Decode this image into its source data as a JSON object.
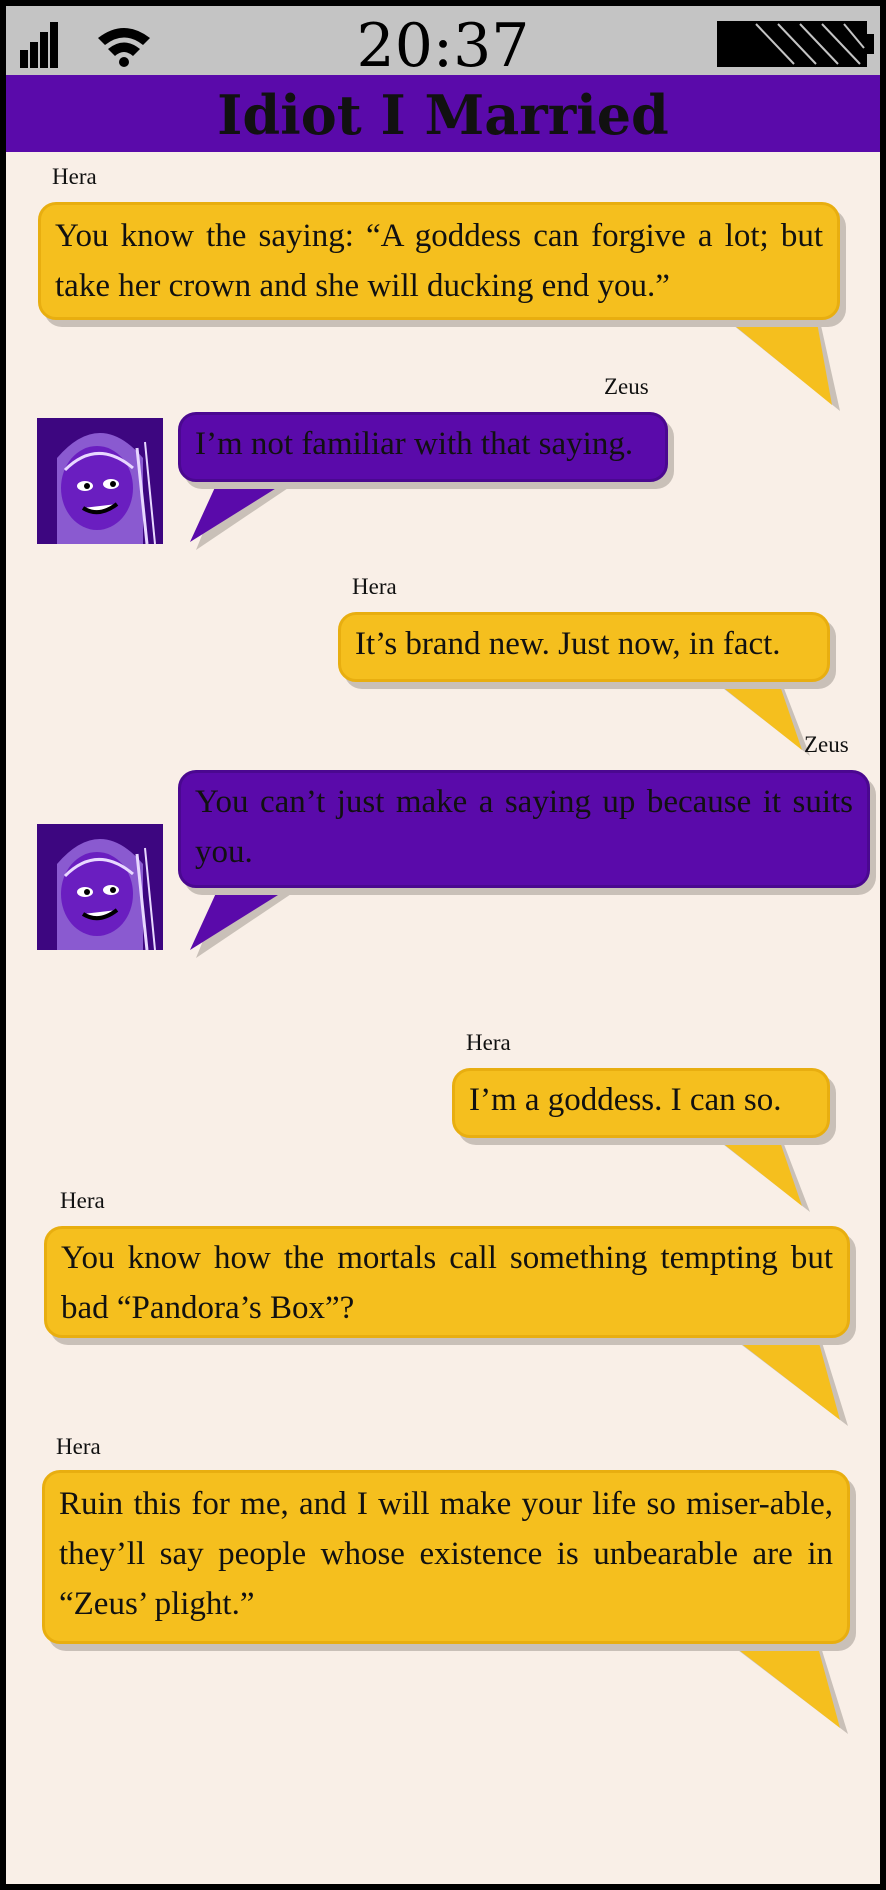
{
  "status_bar": {
    "time": "20:37",
    "signal_icon": "signal-bars-icon",
    "wifi_icon": "wifi-icon",
    "battery_icon": "battery-icon"
  },
  "chat": {
    "title": "Idiot I Married",
    "messages": [
      {
        "sender": "Hera",
        "text": "You know the saying: “A goddess can forgive a lot; but take her crown and she will ducking end you.”"
      },
      {
        "sender": "Zeus",
        "text": "I’m not familiar with that saying."
      },
      {
        "sender": "Hera",
        "text": "It’s brand new. Just now, in fact."
      },
      {
        "sender": "Zeus",
        "text": "You can’t just make a saying up because it suits you."
      },
      {
        "sender": "Hera",
        "text": "I’m a goddess. I can so."
      },
      {
        "sender": "Hera",
        "text": "You know how the mortals call something tempting but bad “Pandora’s Box”?"
      },
      {
        "sender": "Hera",
        "text": "Ruin this for me, and I will make your life so miser-able, they’ll say people whose existence is unbearable are in “Zeus’ plight.”"
      }
    ]
  },
  "colors": {
    "hera_bubble": "#f5bf1e",
    "zeus_bubble": "#5a0aaa",
    "title_bar": "#5a0aaa",
    "status_bar": "#c4c4c4",
    "chat_background": "#f9efe7"
  }
}
